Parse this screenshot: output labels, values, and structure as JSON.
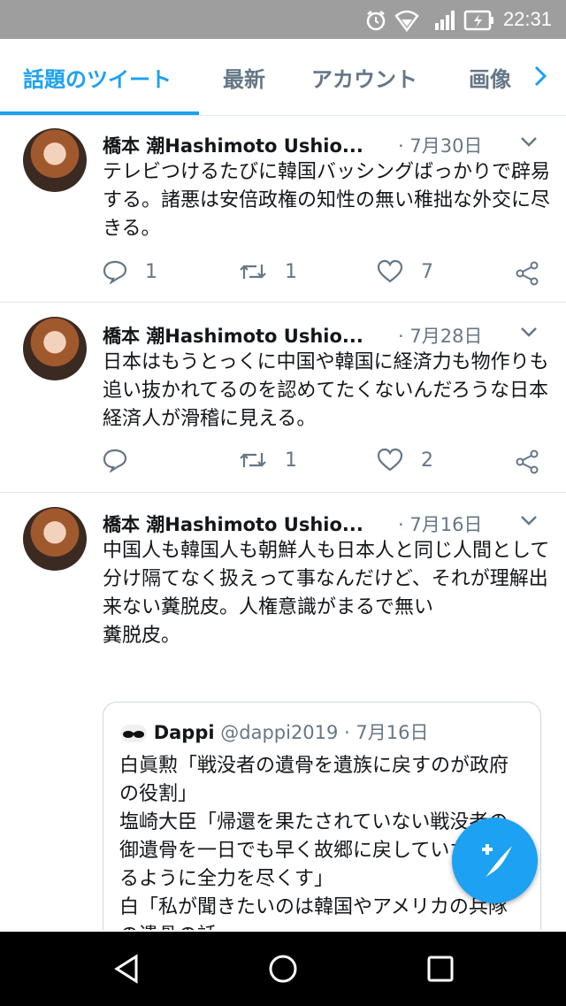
{
  "status": {
    "time": "22:31"
  },
  "tabs": [
    {
      "label": "話題のツイート",
      "active": true
    },
    {
      "label": "最新"
    },
    {
      "label": "アカウント"
    },
    {
      "label": "画像"
    }
  ],
  "tweets": [
    {
      "author": "橋本 潮Hashimoto Ushio...",
      "date": "· 7月30日",
      "text": "テレビつけるたびに韓国バッシングばっかりで辟易する。諸悪は安倍政権の知性の無い稚拙な外交に尽きる。",
      "replies": "1",
      "retweets": "1",
      "likes": "7"
    },
    {
      "author": "橋本 潮Hashimoto Ushio...",
      "date": "· 7月28日",
      "text": "日本はもうとっくに中国や韓国に経済力も物作りも追い抜かれてるのを認めてたくないんだろうな日本経済人が滑稽に見える。",
      "replies": "",
      "retweets": "1",
      "likes": "2"
    },
    {
      "author": "橋本 潮Hashimoto Ushio...",
      "date": "· 7月16日",
      "text": "中国人も韓国人も朝鮮人も日本人と同じ人間として分け隔てなく扱えって事なんだけど、それが理解出来ない糞脱皮。人権意識がまるで無い\n糞脱皮。",
      "quote": {
        "name": "Dappi",
        "handle": "@dappi2019 · 7月16日",
        "text": "白眞勲「戦没者の遺骨を遺族に戻すのが政府の役割」\n塩崎大臣「帰還を果たされていない戦没者の御遺骨を一日でも早く故郷に戻していただけるように全力を尽くす」\n白「私が聞きたいのは韓国やアメリカの兵隊の遺骨の話」"
      }
    }
  ],
  "colors": {
    "accent": "#1da1f2",
    "muted": "#657786",
    "text": "#14171a",
    "statusbar": "#9e9e9e"
  },
  "icons": [
    "alarm-icon",
    "wifi-icon",
    "signal-icon",
    "battery-icon",
    "chevron-right-icon",
    "caret-down-icon",
    "reply-icon",
    "retweet-icon",
    "like-icon",
    "share-icon",
    "compose-icon",
    "back-icon",
    "home-icon",
    "recents-icon"
  ]
}
